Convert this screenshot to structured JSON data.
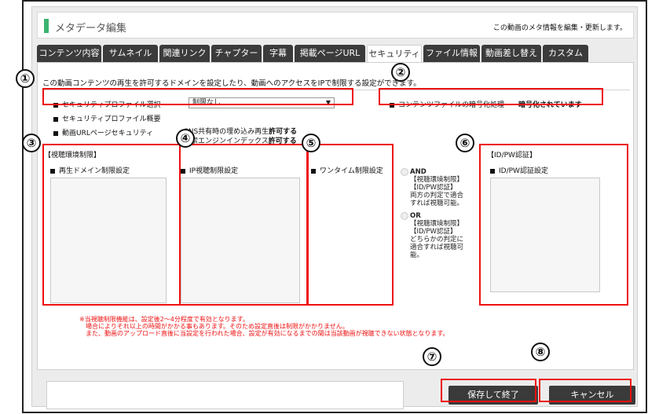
{
  "header": {
    "title": "メタデータ編集",
    "description": "この動画のメタ情報を編集・更新します。"
  },
  "tabs": [
    {
      "label": "コンテンツ内容"
    },
    {
      "label": "サムネイル"
    },
    {
      "label": "関連リンク"
    },
    {
      "label": "チャプター"
    },
    {
      "label": "字幕"
    },
    {
      "label": "掲載ページURL"
    },
    {
      "label": "セキュリティ",
      "active": true
    },
    {
      "label": "ファイル情報"
    },
    {
      "label": "動画差し替え"
    },
    {
      "label": "カスタム"
    }
  ],
  "security": {
    "description": "この動画コンテンツの再生を許可するドメインを設定したり、動画へのアクセスをIPで制限する設定ができます。",
    "profile_select_label": "セキュリティプロファイル選択",
    "profile_select_value": "制限なし",
    "profile_overview_label": "セキュリティプロファイル概要",
    "url_page_security_label": "動画URLページセキュリティ",
    "sns_embed_text": "SNS共有時の埋め込み再生",
    "sns_embed_value": "許可する",
    "search_index_text": "検索エンジンインデックス",
    "search_index_value": "許可する",
    "encryption_label": "コンテンツファイルの暗号化処理",
    "encryption_value": "暗号化されています"
  },
  "restrictions": {
    "title": "【視聴環境制限】",
    "domain_label": "再生ドメイン制限設定",
    "ip_label": "IP視聴制限設定",
    "onetime_label": "ワンタイム制限設定",
    "idpw_title": "【ID/PW認証】",
    "idpw_label": "ID/PW認証設定"
  },
  "logic_options": [
    {
      "title": "AND",
      "line1": "【視聴環境制限】",
      "line2": "【ID/PW認証】",
      "line3": "両方の判定で適合",
      "line4": "すれば視聴可能。"
    },
    {
      "title": "OR",
      "line1": "【視聴環境制限】",
      "line2": "【ID/PW認証】",
      "line3": "どちらかの判定に",
      "line4": "適合すれば視聴可",
      "line5": "能。"
    }
  ],
  "notes": [
    "※当視聴制限機能は、設定後2～4分程度で有効となります。",
    "場合によりそれ以上の時間がかかる事もあります。そのため設定直後は制限がかかりません。",
    "また、動画のアップロード直後に当設定を行われた場合、設定が有効になるまでの間は当該動画が視聴できない状態となります。"
  ],
  "buttons": {
    "save_label": "保存して終了",
    "cancel_label": "キャンセル"
  },
  "callouts": [
    "①",
    "②",
    "③",
    "④",
    "⑤",
    "⑥",
    "⑦",
    "⑧"
  ],
  "colors": {
    "accent_green": "#3cb371",
    "callout_red": "#ee1111",
    "tab_dark": "#3b3b3b",
    "button_dark": "#3a3a3a"
  }
}
